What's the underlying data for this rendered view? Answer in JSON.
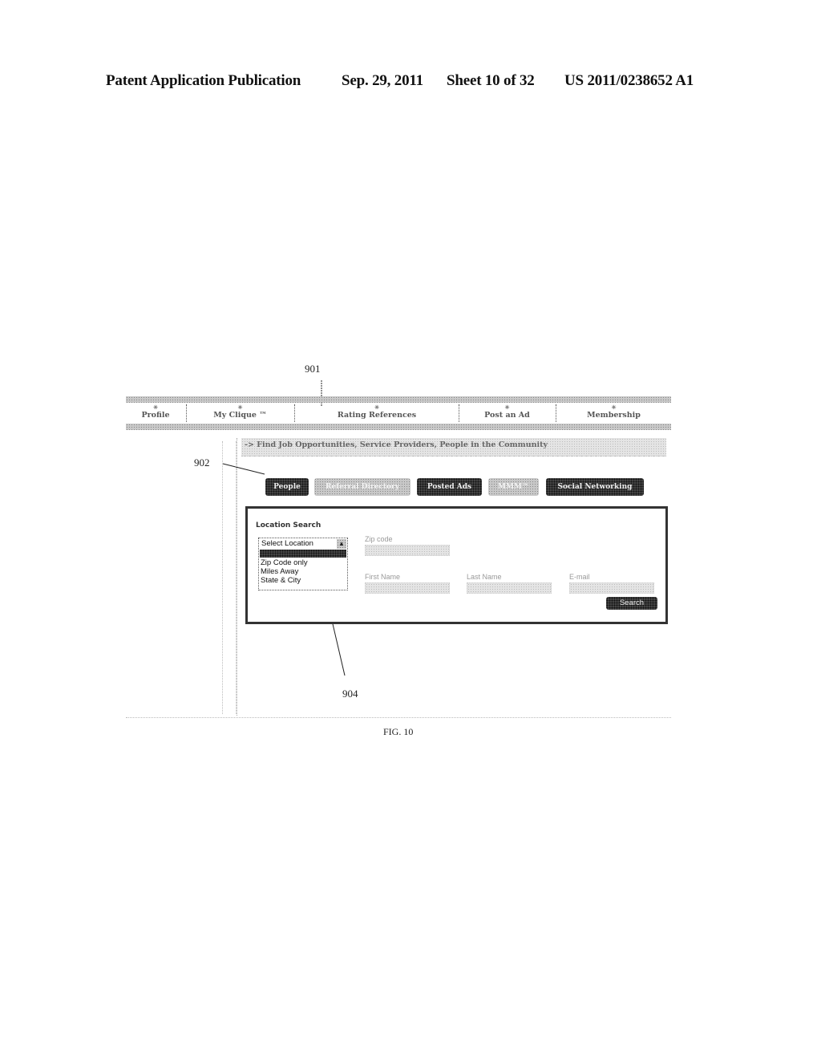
{
  "header": {
    "publication": "Patent Application Publication",
    "date": "Sep. 29, 2011",
    "sheet": "Sheet 10 of 32",
    "number": "US 2011/0238652 A1"
  },
  "reference_numerals": {
    "nav": "901",
    "tabs": "902",
    "dropdown": "904"
  },
  "nav": {
    "items": [
      {
        "label": "Profile"
      },
      {
        "label": "My Clique ™"
      },
      {
        "label": "Rating References"
      },
      {
        "label": "Post an Ad"
      },
      {
        "label": "Membership"
      }
    ]
  },
  "main": {
    "heading": "-> Find Job Opportunities, Service Providers, People in the Community",
    "tabs": [
      {
        "label": "People",
        "state": "active"
      },
      {
        "label": "Referral Directory",
        "state": "inactive"
      },
      {
        "label": "Posted Ads",
        "state": "active"
      },
      {
        "label": "MMM™",
        "state": "inactive"
      },
      {
        "label": "Social Networking",
        "state": "active"
      }
    ],
    "search": {
      "title": "Location Search",
      "select": {
        "current": "Select Location",
        "options": [
          "Select Location",
          "Zip Code only",
          "Miles Away",
          "State & City"
        ]
      },
      "fields": {
        "zip": {
          "label": "Zip code",
          "value": ""
        },
        "first_name": {
          "label": "First Name",
          "value": ""
        },
        "last_name": {
          "label": "Last Name",
          "value": ""
        },
        "email": {
          "label": "E-mail",
          "value": ""
        }
      },
      "button": "Search"
    }
  },
  "figure_caption": "FIG. 10"
}
